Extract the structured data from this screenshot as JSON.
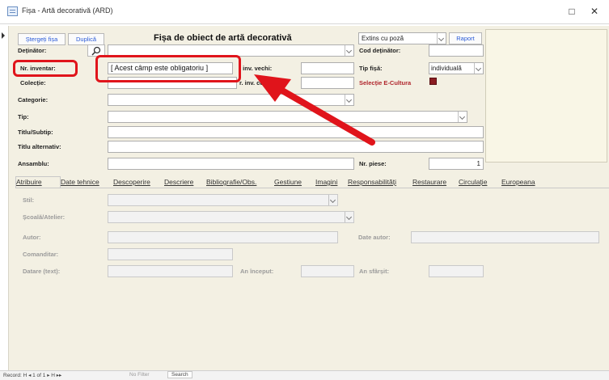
{
  "window": {
    "title": "Fișa - Artă decorativă (ARD)",
    "minimize_glyph": "□",
    "close_glyph": "✕"
  },
  "header": {
    "delete_label": "Ștergeți fișa",
    "duplicate_label": "Duplică",
    "form_title": "Fișa de obiect de artă decorativă",
    "view_select_value": "Extins cu poză",
    "report_label": "Raport"
  },
  "labels": {
    "detinator": "Deținător:",
    "cod_detinator": "Cod deținător:",
    "nr_inventar": "Nr. inventar:",
    "nr_inv_vechi": ". inv. vechi:",
    "tip_fisa": "Tip fișă:",
    "colectie": "Colecție:",
    "nr_inv_colectie": "r. inv. colecție:",
    "selectie": "Selecție E-Cultura",
    "categorie": "Categorie:",
    "tip": "Tip:",
    "titlu_subtip": "Titlu/Subtip:",
    "titlu_alternativ": "Titlu alternativ:",
    "ansamblu": "Ansamblu:",
    "nr_piese": "Nr. piese:"
  },
  "fields": {
    "nr_inventar_value": "[ Acest câmp este obligatoriu ]",
    "tip_fisa_value": "individuală",
    "nr_piese_value": "1"
  },
  "tabs": [
    "Atribuire",
    "Date tehnice",
    "Descoperire",
    "Descriere",
    "Bibliografie/Obs.",
    "Gestiune",
    "Imagini",
    "Responsabilități",
    "Restaurare",
    "Circulație",
    "Europeana"
  ],
  "attrib": {
    "stil": "Stil:",
    "scoala": "Școală/Atelier:",
    "autor": "Autor:",
    "date_autor": "Date autor:",
    "comanditar": "Comanditar:",
    "datare": "Datare (text):",
    "an_inceput": "An început:",
    "an_sfarsit": "An sfârșit:"
  },
  "status": {
    "record": "Record: H  ◂  1 of 1  ▸  H  ▸▸",
    "filter": "No Filter",
    "search": "Search"
  },
  "colors": {
    "highlight": "#e0141b",
    "form_bg": "#f3f0e3"
  }
}
